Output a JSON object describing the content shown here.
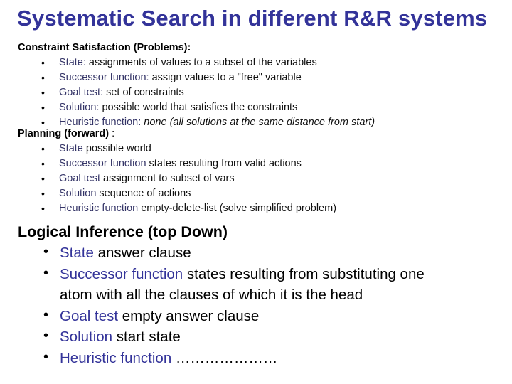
{
  "title": "Systematic Search in different R&R systems",
  "sections": [
    {
      "heading": "Constraint Satisfaction (Problems):",
      "heading_suffix": "",
      "items": [
        {
          "term": "State:",
          "text": " assignments of values to a subset of the variables",
          "italic": ""
        },
        {
          "term": "Successor function:",
          "text": " assign values to a \"free\" variable",
          "italic": ""
        },
        {
          "term": "Goal test:",
          "text": " set of constraints",
          "italic": ""
        },
        {
          "term": "Solution:",
          "text": " possible world that satisfies the constraints",
          "italic": ""
        },
        {
          "term": "Heuristic function:",
          "text": " ",
          "italic": "none (all solutions at the same distance from start)"
        }
      ]
    },
    {
      "heading": "Planning (forward)",
      "heading_suffix": " :",
      "items": [
        {
          "term": "State",
          "text": " possible world",
          "italic": ""
        },
        {
          "term": "Successor function",
          "text": " states resulting from valid actions",
          "italic": ""
        },
        {
          "term": "Goal test",
          "text": " assignment to subset of vars",
          "italic": ""
        },
        {
          "term": "Solution",
          "text": " sequence of actions",
          "italic": ""
        },
        {
          "term": "Heuristic function",
          "text": " empty-delete-list (solve simplified problem)",
          "italic": ""
        }
      ]
    },
    {
      "heading": "Logical Inference (top Down)",
      "heading_suffix": "",
      "items": [
        {
          "term": "State",
          "text": " answer clause",
          "cont": ""
        },
        {
          "term": "Successor function",
          "text": " states resulting from substituting one",
          "cont": "atom with all the clauses of which it is the head"
        },
        {
          "term": "Goal test",
          "text": " empty answer clause",
          "cont": ""
        },
        {
          "term": "Solution",
          "text": " start state",
          "cont": ""
        },
        {
          "term": "Heuristic function",
          "text": " …………………",
          "cont": ""
        }
      ]
    }
  ],
  "bullet_glyph": "•"
}
